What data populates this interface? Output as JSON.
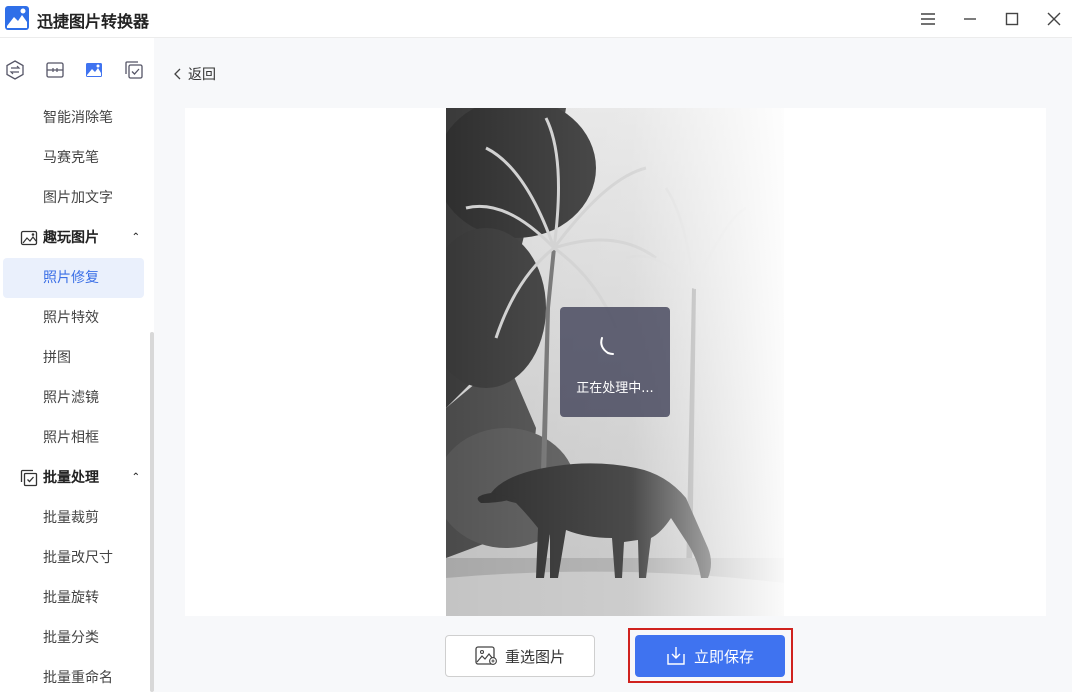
{
  "app": {
    "title": "迅捷图片转换器"
  },
  "toolbar_icons": [
    "convert-icon",
    "compress-icon",
    "image-edit-icon",
    "batch-icon"
  ],
  "sidebar": {
    "items_top": [
      "智能消除笔",
      "马赛克笔",
      "图片加文字"
    ],
    "group_fun": {
      "label": "趣玩图片",
      "items": [
        "照片修复",
        "照片特效",
        "拼图",
        "照片滤镜",
        "照片相框"
      ],
      "active": "照片修复"
    },
    "group_batch": {
      "label": "批量处理",
      "items": [
        "批量裁剪",
        "批量改尺寸",
        "批量旋转",
        "批量分类",
        "批量重命名"
      ]
    }
  },
  "main": {
    "back_label": "返回",
    "loading_text": "正在处理中...",
    "reselect_label": "重选图片",
    "save_label": "立即保存"
  },
  "colors": {
    "accent": "#3f73f0",
    "highlight": "#d0221e",
    "active_bg": "#eaf0fc"
  }
}
